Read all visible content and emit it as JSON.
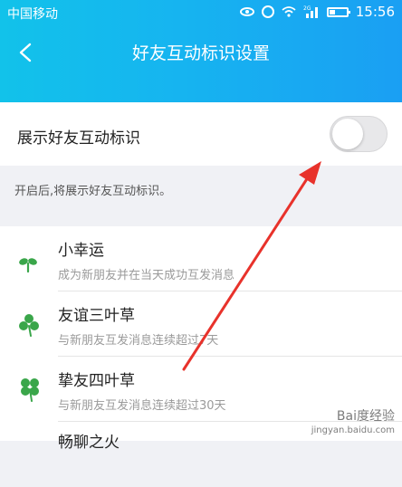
{
  "status_bar": {
    "carrier": "中国移动",
    "time": "15:56",
    "network_badge": "2G"
  },
  "nav": {
    "title": "好友互动标识设置"
  },
  "toggle_row": {
    "label": "展示好友互动标识",
    "enabled": false
  },
  "hint": "开启后,将展示好友互动标识。",
  "items": [
    {
      "title": "小幸运",
      "desc": "成为新朋友并在当天成功互发消息",
      "icon": "sprout-icon"
    },
    {
      "title": "友谊三叶草",
      "desc": "与新朋友互发消息连续超过7天",
      "icon": "three-leaf-clover-icon"
    },
    {
      "title": "挚友四叶草",
      "desc": "与新朋友互发消息连续超过30天",
      "icon": "four-leaf-clover-icon"
    },
    {
      "title": "畅聊之火",
      "desc": "",
      "icon": "fire-icon"
    }
  ],
  "watermark": {
    "text": "Bai度经验",
    "url": "jingyan.baidu.com"
  },
  "colors": {
    "header_start": "#12c2ea",
    "header_end": "#1a9ff3",
    "leaf_green": "#3aa64a",
    "annotation_red": "#e8322b"
  }
}
